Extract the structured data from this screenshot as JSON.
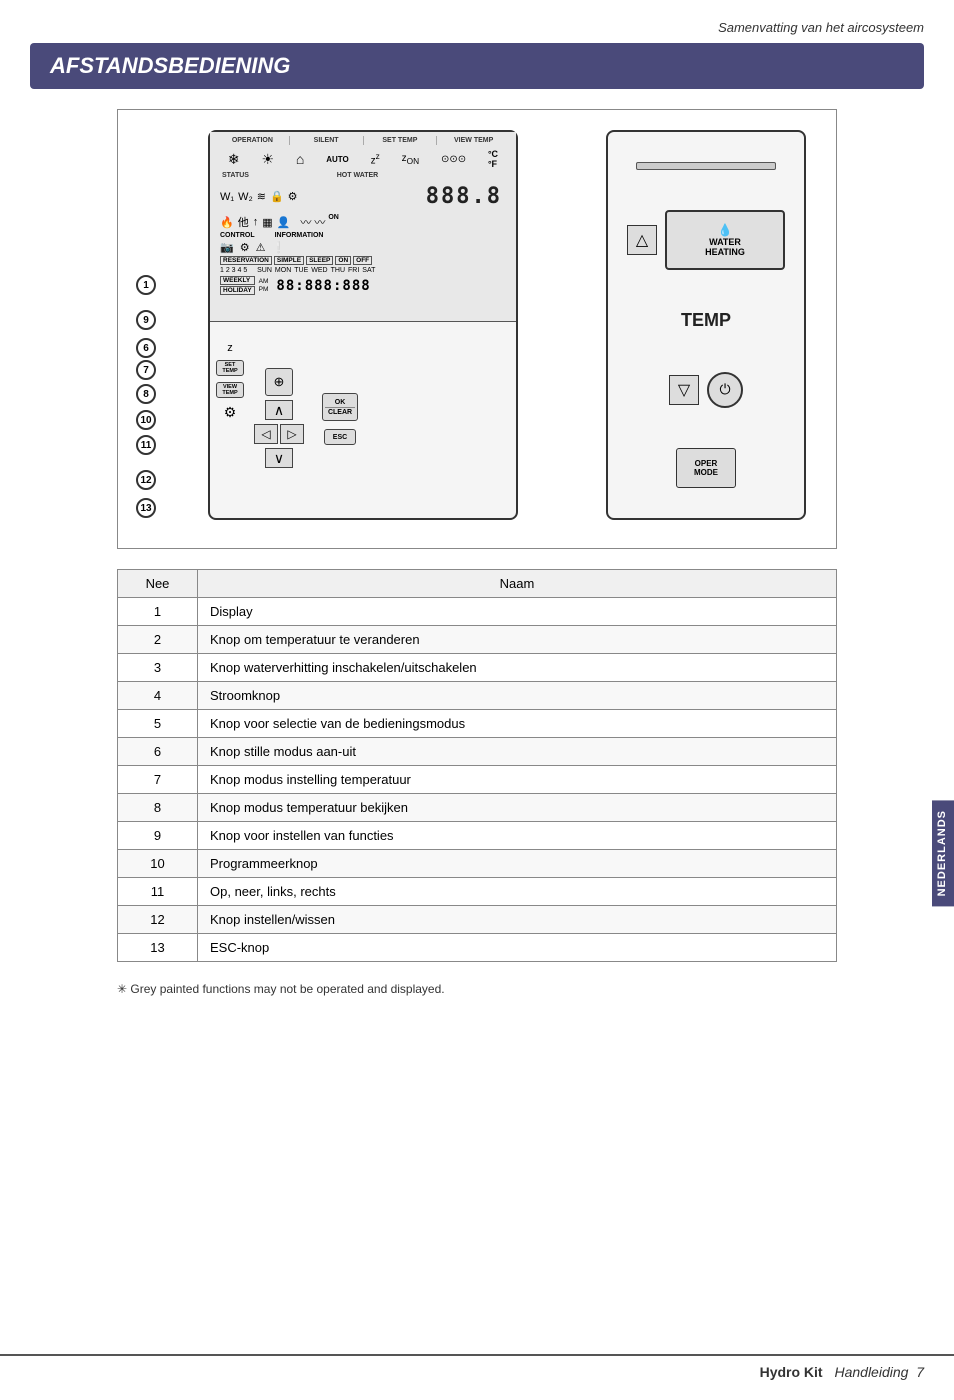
{
  "page": {
    "subtitle": "Samenvatting van het aircosysteem",
    "section_title": "AFSTANDSBEDIENING",
    "bottom_brand": "Hydro Kit",
    "bottom_text": "Handleiding",
    "bottom_page": "7"
  },
  "remote_left": {
    "labels": {
      "operation": "OPERATION",
      "silent": "SILENT",
      "set_temp": "SET TEMP",
      "view_temp": "VIEW TEMP",
      "status": "STATUS",
      "hot_water": "HOT WATER",
      "control": "CONTROL",
      "information": "INFORMATION",
      "reservation": "RESERVATION",
      "simple": "SIMPLE",
      "sleep": "SLEEP",
      "on": "ON",
      "off": "OFF",
      "weekly": "WEEKLY",
      "holiday": "HOLIDAY",
      "auto": "AUTO",
      "on2": "ON",
      "am": "AM",
      "pm": "PM"
    },
    "digital_display": "888.8",
    "digital_display2": "88:888:888",
    "days": [
      "SUN",
      "MON",
      "TUE",
      "WED",
      "THU",
      "FRI",
      "SAT"
    ],
    "reservation_nums": "1 2 3 4 5",
    "buttons": {
      "set_temp": "SET\nTEMP",
      "view_temp": "VIEW\nTEMP",
      "ok_clear": "OK\nCLEAR",
      "esc": "ESC"
    }
  },
  "remote_right": {
    "water_heating": "WATER\nHEATING",
    "temp_label": "TEMP",
    "oper_mode": "OPER\nMODE"
  },
  "numbered_items": [
    {
      "num": "1",
      "label": "Display"
    },
    {
      "num": "2",
      "label": "Knop om temperatuur te veranderen"
    },
    {
      "num": "3",
      "label": "Knop waterverhitting inschakelen/uitschakelen"
    },
    {
      "num": "4",
      "label": "Stroomknop"
    },
    {
      "num": "5",
      "label": "Knop voor selectie van de bedieningsmodus"
    },
    {
      "num": "6",
      "label": "Knop stille modus aan-uit"
    },
    {
      "num": "7",
      "label": "Knop modus instelling temperatuur"
    },
    {
      "num": "8",
      "label": "Knop modus temperatuur bekijken"
    },
    {
      "num": "9",
      "label": "Knop voor instellen van functies"
    },
    {
      "num": "10",
      "label": "Programmeerknop"
    },
    {
      "num": "11",
      "label": "Op, neer, links, rechts"
    },
    {
      "num": "12",
      "label": "Knop instellen/wissen"
    },
    {
      "num": "13",
      "label": "ESC-knop"
    }
  ],
  "table_headers": [
    "Nee",
    "Naam"
  ],
  "footnote": "✳ Grey painted functions may not be operated and displayed.",
  "side_tab": "NEDERLANDS"
}
